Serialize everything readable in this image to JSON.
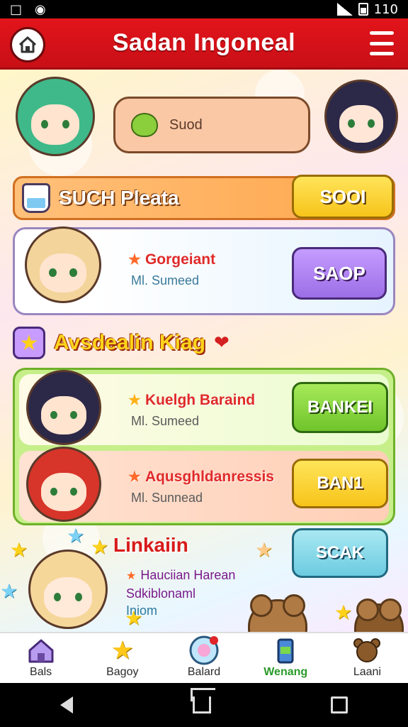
{
  "status_bar": {
    "battery_level": "110"
  },
  "app_bar": {
    "title": "Sadan Ingoneal"
  },
  "search": {
    "label": "Suod"
  },
  "orange_row": {
    "title": "SUCH Pleata",
    "button": "SOOI"
  },
  "card1": {
    "name": "Gorgeiant",
    "sub": "Ml. Sumeed",
    "button": "SAOP"
  },
  "section": {
    "title": "Avsdealin Kiag"
  },
  "card2": {
    "name": "Kuelgh Baraind",
    "sub": "Ml. Sumeed",
    "button": "BANKEI"
  },
  "card3": {
    "name": "Aqusghldanressis",
    "sub": "Ml. Sunnead",
    "button": "BAN1"
  },
  "linkain": {
    "title": "Linkaiin",
    "line1": "Hauciian Harean",
    "line2": "Sdkiblonaml",
    "line3": "Iniom",
    "button": "SCAK"
  },
  "bottom_nav": [
    {
      "label": "Bals",
      "icon": "house-icon"
    },
    {
      "label": "Bagoy",
      "icon": "star-icon"
    },
    {
      "label": "Balard",
      "icon": "bubble-icon"
    },
    {
      "label": "Wenang",
      "icon": "drink-icon"
    },
    {
      "label": "Laani",
      "icon": "bear-icon"
    }
  ],
  "colors": {
    "app_bar": "#d6141b",
    "accent_green": "#6fc42a",
    "accent_yellow": "#f7c41a"
  }
}
